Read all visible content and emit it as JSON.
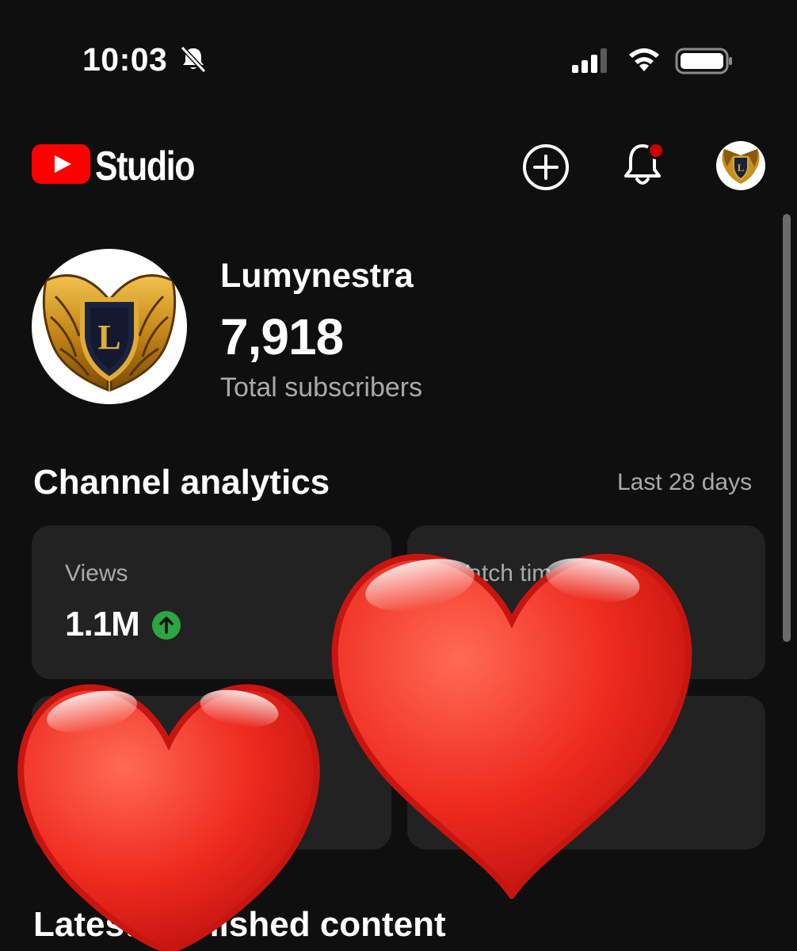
{
  "status_bar": {
    "time": "10:03",
    "icons": [
      "mute-icon",
      "signal-icon",
      "wifi-icon",
      "battery-icon"
    ]
  },
  "header": {
    "app_name": "Studio",
    "logo_color": "#ff0000",
    "actions": [
      "create-icon",
      "notification-bell-icon",
      "avatar"
    ],
    "notification_dot_color": "#cc0000"
  },
  "channel": {
    "name": "Lumynestra",
    "subscriber_count": "7,918",
    "subscriber_label": "Total subscribers",
    "avatar_letter": "L"
  },
  "analytics": {
    "title": "Channel analytics",
    "period": "Last 28 days",
    "cards": [
      {
        "label": "Views",
        "value": "1.1M",
        "trend": "up",
        "trend_color": "#2ba640"
      },
      {
        "label": "Watch time",
        "value": ""
      },
      {
        "label": "",
        "value": ""
      },
      {
        "label": "",
        "value": ""
      }
    ]
  },
  "latest": {
    "title": "Latest published content"
  },
  "overlay": {
    "stickers": [
      "heart-icon",
      "heart-icon"
    ],
    "heart_color": "#e5281e"
  }
}
